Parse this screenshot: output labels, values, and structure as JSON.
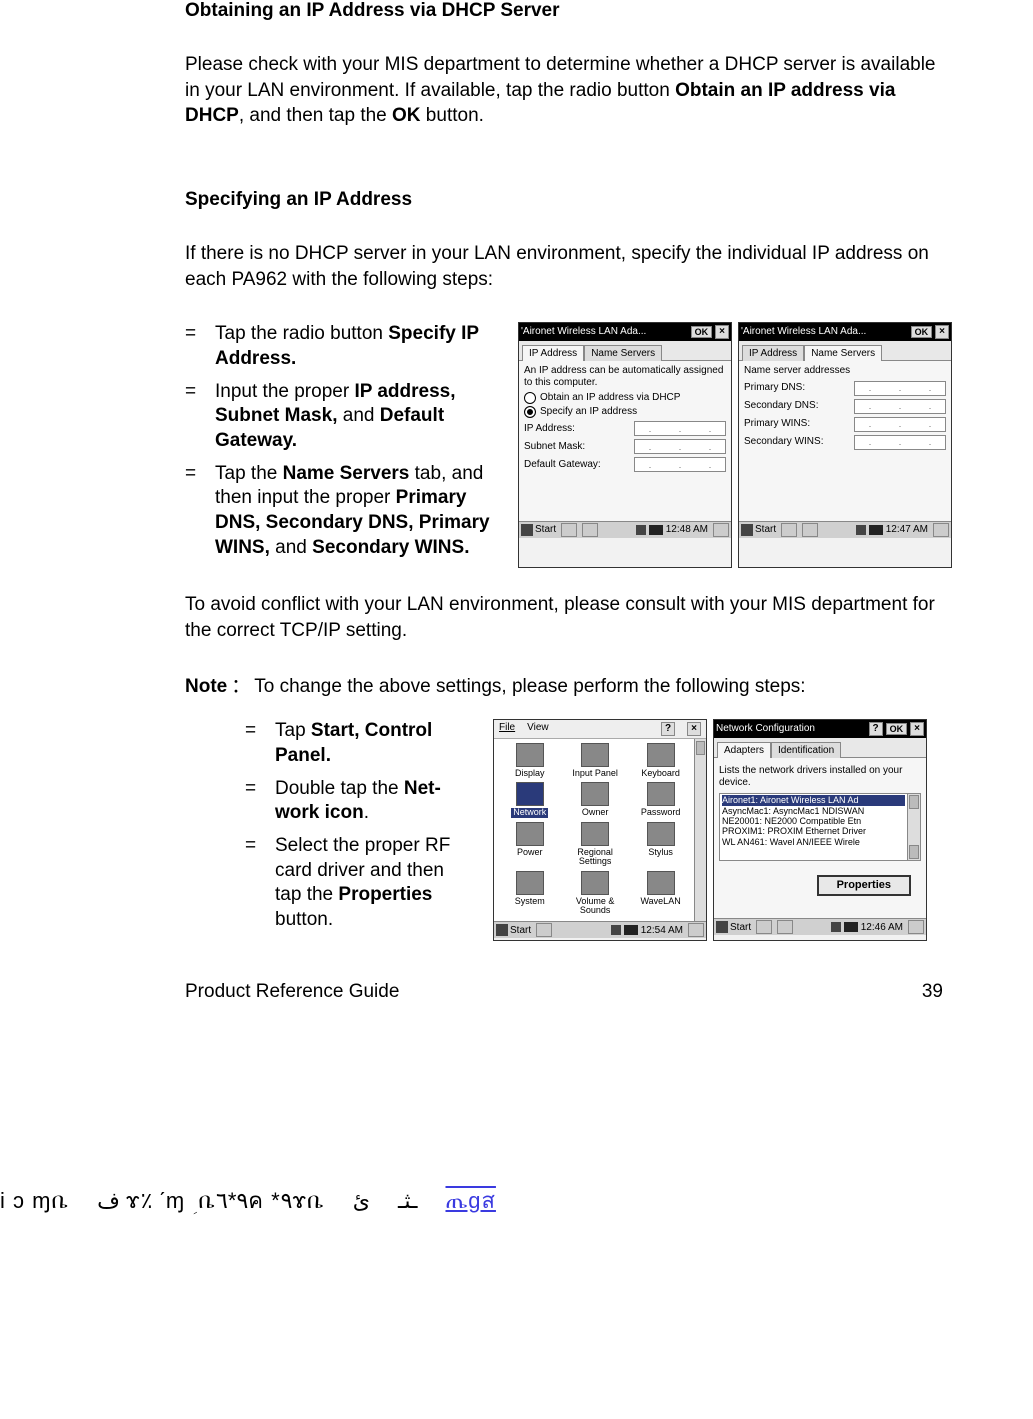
{
  "doc": {
    "h1": "Obtaining an IP Address via DHCP Server",
    "p1_a": "Please check with your MIS department to determine whether a DHCP server is available in your LAN environment.  If available, tap the radio button ",
    "p1_b": "Obtain an IP address via DHCP",
    "p1_c": ", and then tap the ",
    "p1_d": "OK",
    "p1_e": " button.",
    "h2": "Specifying an IP Address",
    "p2": "If there is no DHCP server in your LAN environment, specify the individual IP address on each PA962 with the following steps:",
    "bullets1": [
      {
        "pre": "Tap the radio button ",
        "b": "Specify IP Address.",
        "post": ""
      },
      {
        "pre": "Input the proper ",
        "b": "IP address, Subnet Mask,",
        "post": " and ",
        "b2": "Default Gateway."
      },
      {
        "pre": "Tap the ",
        "b": "Name Servers",
        "post": " tab, and then input the proper ",
        "b2": "Primary DNS, Secondary DNS, Primary WINS,",
        "post2": " and ",
        "b3": "Secondary WINS."
      }
    ],
    "p3": "To avoid conflict with your LAN environment, please consult with your MIS department for the correct TCP/IP setting.",
    "note_lead": "Note",
    "note_colon": "：",
    "note_body": "To change the above settings, please perform the following steps:",
    "bullets2": [
      {
        "pre": "Tap ",
        "b": "Start, Control Panel."
      },
      {
        "pre": "Double tap the ",
        "b": "Net-work icon",
        "post": "."
      },
      {
        "pre": "Select the proper RF card driver and then tap the ",
        "b": "Properties",
        "post": " button."
      }
    ],
    "footer_left": "Product Reference Guide",
    "footer_right": "39",
    "glitch_parts": [
      "i ɔ ɱቤ",
      "ف ɤ٪ ˊɱ  ؚ ቤ٩*٦ค  *٩ɤቤ",
      "ئ",
      "ـثـ",
      "ጤgส"
    ]
  },
  "shots": {
    "ip": {
      "title": "'Aironet Wireless LAN Ada...",
      "ok": "OK",
      "x": "×",
      "tab1": "IP Address",
      "tab2": "Name Servers",
      "desc": "An IP address can be automatically assigned to this computer.",
      "r1": "Obtain an IP address via DHCP",
      "r2": "Specify an IP address",
      "f1": "IP Address:",
      "f2": "Subnet Mask:",
      "f3": "Default Gateway:",
      "start": "Start",
      "time": "12:48 AM"
    },
    "ns": {
      "title": "'Aironet Wireless LAN Ada...",
      "ok": "OK",
      "x": "×",
      "tab1": "IP Address",
      "tab2": "Name Servers",
      "desc": "Name server addresses",
      "f1": "Primary DNS:",
      "f2": "Secondary DNS:",
      "f3": "Primary WINS:",
      "f4": "Secondary WINS:",
      "start": "Start",
      "time": "12:47 AM"
    },
    "cp": {
      "menu_file": "File",
      "menu_view": "View",
      "q": "?",
      "x": "×",
      "items": [
        "Display",
        "Input Panel",
        "Keyboard",
        "Network",
        "Owner",
        "Password",
        "Power",
        "Regional Settings",
        "Stylus",
        "System",
        "Volume & Sounds",
        "WaveLAN"
      ],
      "selected_index": 3,
      "start": "Start",
      "time": "12:54 AM"
    },
    "nc": {
      "title": "Network Configuration",
      "q": "?",
      "ok": "OK",
      "x": "×",
      "tab1": "Adapters",
      "tab2": "Identification",
      "desc": "Lists the network drivers installed on your device.",
      "rows": [
        "Aironet1: Aironet Wireless LAN Ad",
        "AsyncMac1: AsyncMac1 NDISWAN",
        "NE20001: NE2000 Compatible Etn",
        "PROXIM1: PROXIM Ethernet Driver",
        "WL AN461: Wavel AN/IEEE Wirele"
      ],
      "selected_index": 0,
      "props": "Properties",
      "start": "Start",
      "time": "12:46 AM"
    }
  }
}
